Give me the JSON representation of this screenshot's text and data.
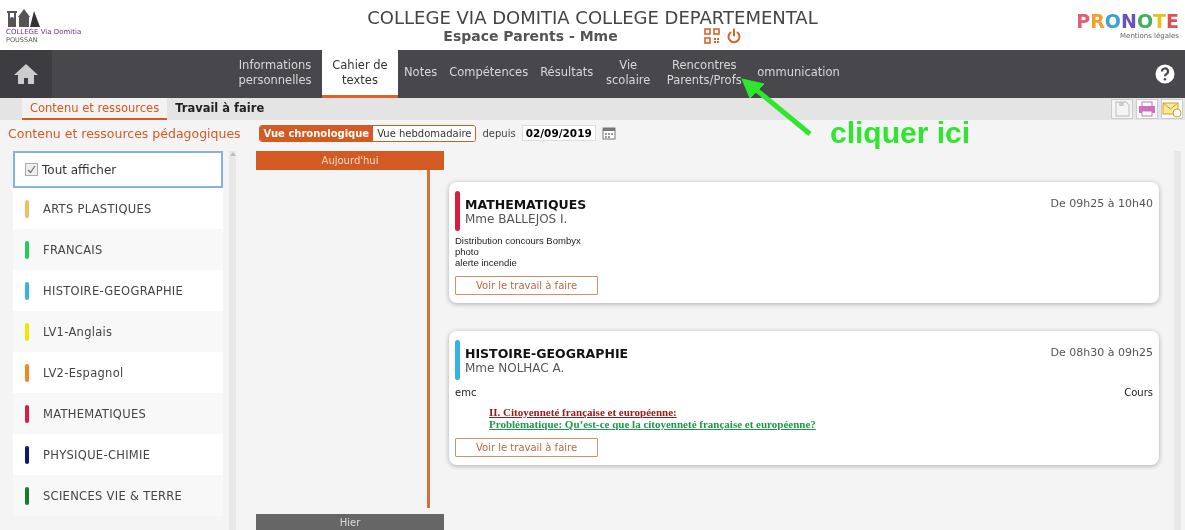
{
  "header": {
    "school_logo": {
      "caption": "COLLEGE Via Domitia",
      "town": "POUSSAN"
    },
    "title": "COLLEGE VIA DOMITIA COLLEGE DEPARTEMENTAL",
    "subtitle": "Espace Parents - Mme",
    "brand": "PRONOTE",
    "legal_link": "Mentions légales"
  },
  "nav": {
    "tabs": [
      {
        "label": "Informations personnelles",
        "selected": false
      },
      {
        "label": "Cahier de textes",
        "selected": true
      },
      {
        "label": "Notes",
        "selected": false
      },
      {
        "label": "Compétences",
        "selected": false
      },
      {
        "label": "Résultats",
        "selected": false
      },
      {
        "label": "Vie scolaire",
        "selected": false
      },
      {
        "label": "Rencontres Parents/Profs",
        "selected": false
      },
      {
        "label": "ommunication",
        "selected": false
      }
    ]
  },
  "subtabs": [
    {
      "label": "Contenu et ressources",
      "selected": true
    },
    {
      "label": "Travail à faire",
      "selected": false
    }
  ],
  "toolbar": {
    "title": "Contenu et ressources pédagogiques",
    "views": [
      {
        "label": "Vue chronologique",
        "selected": true
      },
      {
        "label": "Vue hebdomadaire",
        "selected": false
      }
    ],
    "since_label": "depuis",
    "since_date": "02/09/2019"
  },
  "sidebar": {
    "show_all": {
      "label": "Tout afficher",
      "checked": true
    },
    "items": [
      {
        "label": "ARTS PLASTIQUES",
        "color": "#f0c060"
      },
      {
        "label": "FRANCAIS",
        "color": "#22cc55"
      },
      {
        "label": "HISTOIRE-GEOGRAPHIE",
        "color": "#33b5e0"
      },
      {
        "label": "LV1-Anglais",
        "color": "#f2e600"
      },
      {
        "label": "LV2-Espagnol",
        "color": "#f08a20"
      },
      {
        "label": "MATHEMATIQUES",
        "color": "#dd1a44"
      },
      {
        "label": "PHYSIQUE-CHIMIE",
        "color": "#101870"
      },
      {
        "label": "SCIENCES VIE & TERRE",
        "color": "#157a2a"
      }
    ]
  },
  "timeline": {
    "today": "Aujourd'hui",
    "yesterday": "Hier"
  },
  "lessons": [
    {
      "subject": "MATHEMATIQUES",
      "color": "#dd1a44",
      "teacher": "Mme BALLEJOS I.",
      "time": "De 09h25 à 10h40",
      "lines": [
        {
          "kind": "plain",
          "text": "Distribution concours Bombyx"
        },
        {
          "kind": "plain",
          "text": "photo"
        },
        {
          "kind": "plain",
          "text": "alerte incendie"
        }
      ],
      "button": "Voir le travail à faire"
    },
    {
      "subject": "HISTOIRE-GEOGRAPHIE",
      "color": "#33b5e0",
      "teacher": "Mme NOLHAC A.",
      "time": "De 08h30 à 09h25",
      "topic": "emc",
      "type": "Cours",
      "lines": [
        {
          "kind": "section",
          "text": "II. Citoyenneté française et européenne:"
        },
        {
          "kind": "question",
          "text": "Problématique: Qu’est-ce que la citoyenneté française et européenne?"
        }
      ],
      "button": "Voir le travail à faire"
    }
  ],
  "annotation": {
    "text": "cliquer ici"
  }
}
